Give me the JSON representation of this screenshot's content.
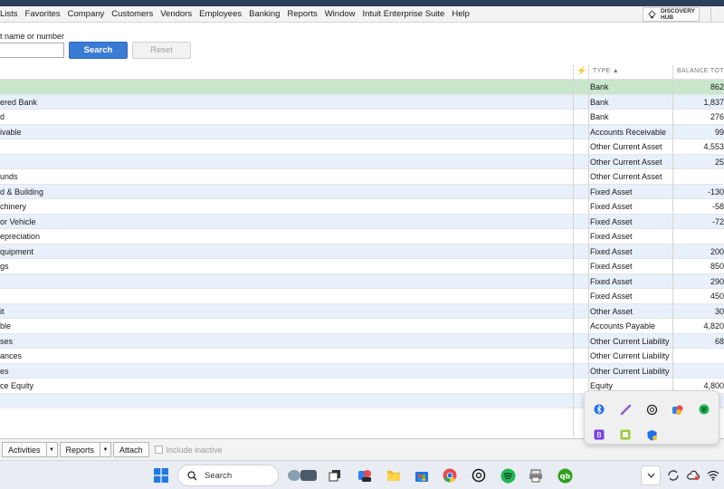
{
  "menu": [
    "Lists",
    "Favorites",
    "Company",
    "Customers",
    "Vendors",
    "Employees",
    "Banking",
    "Reports",
    "Window",
    "Intuit Enterprise Suite",
    "Help"
  ],
  "discovery_hub": {
    "line1": "DISCOVERY",
    "line2": "HUB"
  },
  "search": {
    "label": "t name or number",
    "value": "",
    "search_label": "Search",
    "reset_label": "Reset"
  },
  "columns": {
    "flash": "⚡",
    "type": "TYPE ▲",
    "balance": "BALANCE TOT"
  },
  "rows": [
    {
      "name": "",
      "type": "Bank",
      "balance": "862"
    },
    {
      "name": "ered Bank",
      "type": "Bank",
      "balance": "1,837"
    },
    {
      "name": "d",
      "type": "Bank",
      "balance": "276"
    },
    {
      "name": "ivable",
      "type": "Accounts Receivable",
      "balance": "99"
    },
    {
      "name": "",
      "type": "Other Current Asset",
      "balance": "4,553"
    },
    {
      "name": "",
      "type": "Other Current Asset",
      "balance": "25"
    },
    {
      "name": "unds",
      "type": "Other Current Asset",
      "balance": ""
    },
    {
      "name": "d & Building",
      "type": "Fixed Asset",
      "balance": "-130"
    },
    {
      "name": "chinery",
      "type": "Fixed Asset",
      "balance": "-58"
    },
    {
      "name": "or Vehicle",
      "type": "Fixed Asset",
      "balance": "-72"
    },
    {
      "name": "epreciation",
      "type": "Fixed Asset",
      "balance": ""
    },
    {
      "name": "quipment",
      "type": "Fixed Asset",
      "balance": "200"
    },
    {
      "name": "gs",
      "type": "Fixed Asset",
      "balance": "850"
    },
    {
      "name": "",
      "type": "Fixed Asset",
      "balance": "290"
    },
    {
      "name": "",
      "type": "Fixed Asset",
      "balance": "450"
    },
    {
      "name": "it",
      "type": "Other Asset",
      "balance": "30"
    },
    {
      "name": "ble",
      "type": "Accounts Payable",
      "balance": "4,820"
    },
    {
      "name": "ses",
      "type": "Other Current Liability",
      "balance": "68"
    },
    {
      "name": "ances",
      "type": "Other Current Liability",
      "balance": ""
    },
    {
      "name": "es",
      "type": "Other Current Liability",
      "balance": ""
    },
    {
      "name": "ce Equity",
      "type": "Equity",
      "balance": "4,800"
    },
    {
      "name": "",
      "type": "",
      "balance": ""
    }
  ],
  "bottom": {
    "activities": "Activities",
    "reports": "Reports",
    "attach": "Attach",
    "include_inactive": "Include inactive"
  },
  "taskbar": {
    "search_placeholder": "Search"
  },
  "colors": {
    "accent": "#3a7bd5",
    "selected_row": "#c9e8cb",
    "alt_row": "#e8f0fb",
    "title_bar": "#2c3e5c"
  },
  "tray_icons": [
    "bluetooth-icon",
    "pen-icon",
    "chatgpt-icon",
    "photos-icon",
    "spotify-icon",
    "bitwarden-icon",
    "nvidia-icon",
    "defender-icon"
  ]
}
